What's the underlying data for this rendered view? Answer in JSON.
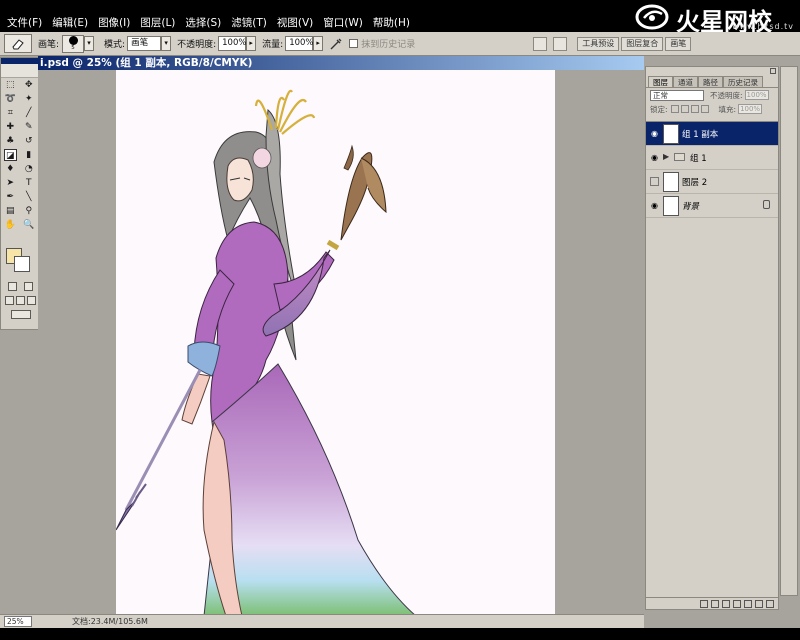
{
  "menubar": {
    "items": [
      "文件(F)",
      "编辑(E)",
      "图像(I)",
      "图层(L)",
      "选择(S)",
      "滤镜(T)",
      "视图(V)",
      "窗口(W)",
      "帮助(H)"
    ]
  },
  "logo": {
    "title": "火星网校",
    "url": "www.hxsd.tv"
  },
  "options_bar": {
    "brush_label": "画笔:",
    "brush_size": "5",
    "mode_label": "模式:",
    "mode_value": "画笔",
    "opacity_label": "不透明度:",
    "opacity_value": "100%",
    "flow_label": "流量:",
    "flow_value": "100%",
    "erase_history_label": "抹到历史记录",
    "well_tabs": [
      "工具预设",
      "图层复合",
      "画笔"
    ]
  },
  "document": {
    "title": "i.psd @ 25% (组 1 副本, RGB/8/CMYK)",
    "zoom": "25%",
    "doc_size": "文档:23.4M/105.6M"
  },
  "layers_panel": {
    "tabs": [
      "图层",
      "通道",
      "路径",
      "历史记录"
    ],
    "blend_mode": "正常",
    "opacity_label": "不透明度:",
    "opacity_value": "100%",
    "lock_label": "锁定:",
    "fill_label": "填充:",
    "fill_value": "100%",
    "layers": [
      {
        "name": "组 1 副本",
        "selected": true,
        "visible": true
      },
      {
        "name": "组 1",
        "selected": false,
        "visible": true,
        "type": "group"
      },
      {
        "name": "图层 2",
        "selected": false,
        "visible": false
      },
      {
        "name": "背景",
        "selected": false,
        "visible": true,
        "locked": true
      }
    ]
  },
  "colors": {
    "foreground": "#f7e4a7",
    "background": "#ffffff",
    "accent": "#0a246a"
  }
}
